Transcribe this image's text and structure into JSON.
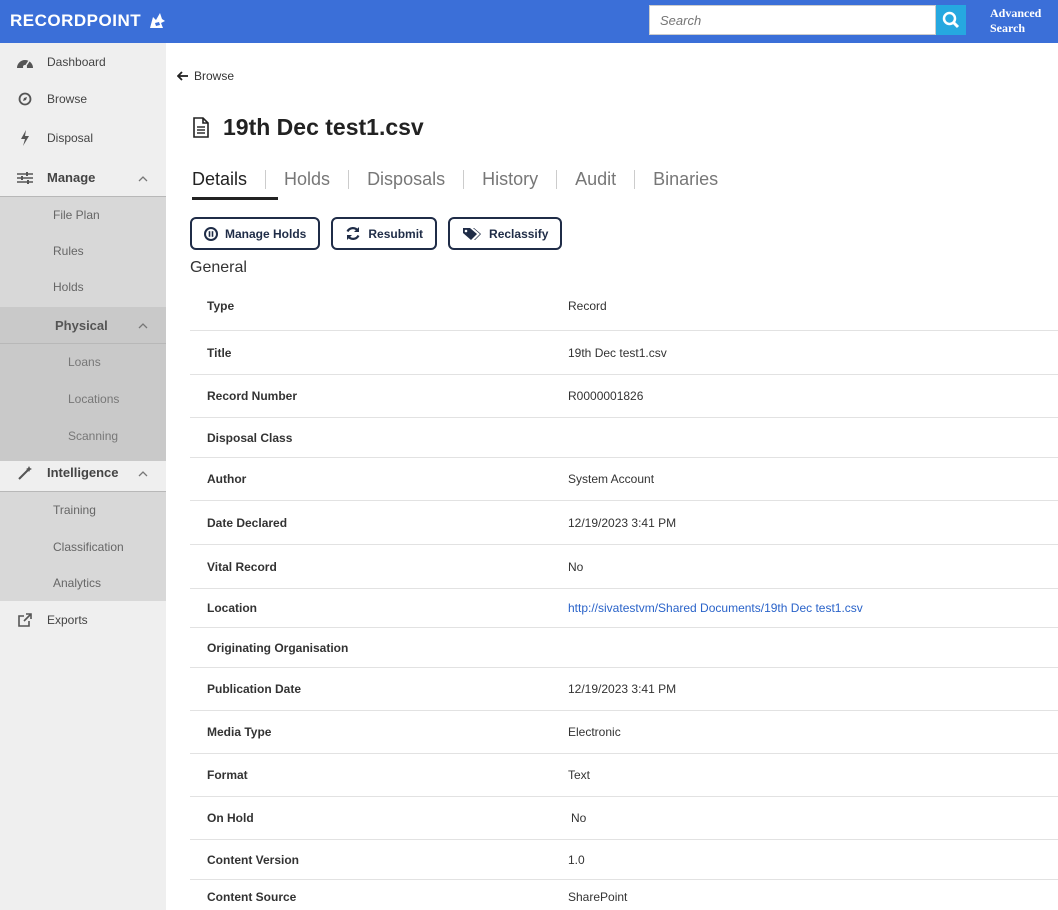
{
  "header": {
    "logo_text": "RECORDPOINT",
    "search_placeholder": "Search",
    "advanced_search_line1": "Advanced",
    "advanced_search_line2": "Search"
  },
  "sidebar": {
    "dashboard": "Dashboard",
    "browse": "Browse",
    "disposal": "Disposal",
    "manage": "Manage",
    "file_plan": "File Plan",
    "rules": "Rules",
    "holds": "Holds",
    "physical": "Physical",
    "loans": "Loans",
    "locations": "Locations",
    "scanning": "Scanning",
    "intelligence": "Intelligence",
    "training": "Training",
    "classification": "Classification",
    "analytics": "Analytics",
    "exports": "Exports"
  },
  "main": {
    "back_label": "Browse",
    "title": "19th Dec test1.csv",
    "tabs": [
      "Details",
      "Holds",
      "Disposals",
      "History",
      "Audit",
      "Binaries"
    ],
    "active_tab": "Details",
    "buttons": {
      "manage_holds": "Manage Holds",
      "resubmit": "Resubmit",
      "reclassify": "Reclassify"
    },
    "section_title": "General",
    "properties": [
      {
        "key": "Type",
        "value": "Record"
      },
      {
        "key": "Title",
        "value": "19th Dec test1.csv"
      },
      {
        "key": "Record Number",
        "value": "R0000001826"
      },
      {
        "key": "Disposal Class",
        "value": ""
      },
      {
        "key": "Author",
        "value": "System Account"
      },
      {
        "key": "Date Declared",
        "value": "12/19/2023 3:41 PM"
      },
      {
        "key": "Vital Record",
        "value": "No"
      },
      {
        "key": "Location",
        "value": "http://sivatestvm/Shared Documents/19th Dec test1.csv"
      },
      {
        "key": "Originating Organisation",
        "value": ""
      },
      {
        "key": "Publication Date",
        "value": "12/19/2023 3:41 PM"
      },
      {
        "key": "Media Type",
        "value": "Electronic"
      },
      {
        "key": "Format",
        "value": "Text"
      },
      {
        "key": "On Hold",
        "value": "No"
      },
      {
        "key": "Content Version",
        "value": "1.0"
      },
      {
        "key": "Content Source",
        "value": "SharePoint"
      }
    ]
  },
  "colors": {
    "topbar": "#3b6fd8",
    "search_button": "#26a8e0",
    "button_border": "#1f2c47",
    "link": "#2a63c9"
  }
}
